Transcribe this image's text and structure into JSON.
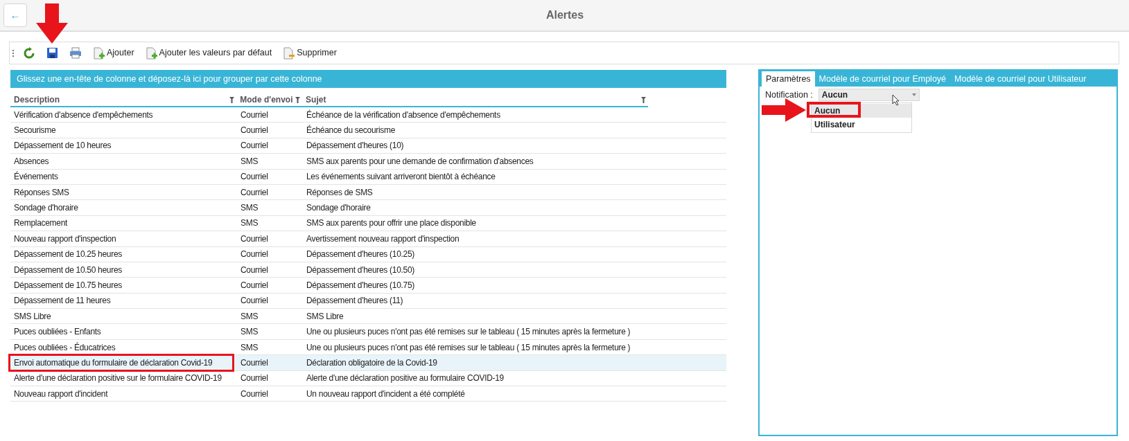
{
  "header": {
    "title": "Alertes",
    "back": "←"
  },
  "toolbar": [
    {
      "kind": "refresh"
    },
    {
      "kind": "save"
    },
    {
      "kind": "print"
    },
    {
      "kind": "add",
      "label": "Ajouter"
    },
    {
      "kind": "add",
      "label": "Ajouter les valeurs par défaut"
    },
    {
      "kind": "delete",
      "label": "Supprimer"
    }
  ],
  "group_panel": "Glissez une en-tête de colonne et déposez-là ici pour grouper par cette colonne",
  "table": {
    "columns": [
      "Description",
      "Mode d'envoi",
      "Sujet"
    ],
    "rows": [
      {
        "description": "Vérification d'absence d'empêchements",
        "mode": "Courriel",
        "subject": "Échéance de la vérification d'absence d'empêchements",
        "selected": false
      },
      {
        "description": "Secourisme",
        "mode": "Courriel",
        "subject": "Échéance du secourisme",
        "selected": false
      },
      {
        "description": "Dépassement de 10 heures",
        "mode": "Courriel",
        "subject": "Dépassement d'heures (10)",
        "selected": false
      },
      {
        "description": "Absences",
        "mode": "SMS",
        "subject": "SMS aux parents pour une demande de confirmation d'absences",
        "selected": false
      },
      {
        "description": "Événements",
        "mode": "Courriel",
        "subject": "Les événements suivant arriveront bientôt à échéance",
        "selected": false
      },
      {
        "description": "Réponses SMS",
        "mode": "Courriel",
        "subject": "Réponses de SMS",
        "selected": false
      },
      {
        "description": "Sondage d'horaire",
        "mode": "SMS",
        "subject": "Sondage d'horaire",
        "selected": false
      },
      {
        "description": "Remplacement",
        "mode": "SMS",
        "subject": "SMS aux parents pour offrir une place disponible",
        "selected": false
      },
      {
        "description": "Nouveau rapport d'inspection",
        "mode": "Courriel",
        "subject": "Avertissement nouveau rapport d'inspection",
        "selected": false
      },
      {
        "description": "Dépassement de 10.25 heures",
        "mode": "Courriel",
        "subject": "Dépassement d'heures (10.25)",
        "selected": false
      },
      {
        "description": "Dépassement de 10.50 heures",
        "mode": "Courriel",
        "subject": "Dépassement d'heures (10.50)",
        "selected": false
      },
      {
        "description": "Dépassement de 10.75 heures",
        "mode": "Courriel",
        "subject": "Dépassement d'heures (10.75)",
        "selected": false
      },
      {
        "description": "Dépassement de 11 heures",
        "mode": "Courriel",
        "subject": "Dépassement d'heures (11)",
        "selected": false
      },
      {
        "description": "SMS Libre",
        "mode": "SMS",
        "subject": "SMS Libre",
        "selected": false
      },
      {
        "description": "Puces oubliées - Enfants",
        "mode": "SMS",
        "subject": "Une ou plusieurs puces n'ont pas été remises sur le tableau ( 15 minutes après la fermeture )",
        "selected": false
      },
      {
        "description": "Puces oubliées - Éducatrices",
        "mode": "SMS",
        "subject": "Une ou plusieurs puces n'ont pas été remises sur le tableau ( 15 minutes après la fermeture )",
        "selected": false
      },
      {
        "description": "Envoi automatique du formulaire de déclaration Covid-19",
        "mode": "Courriel",
        "subject": "Déclaration obligatoire de la Covid-19",
        "selected": true
      },
      {
        "description": "Alerte d'une déclaration positive sur le formulaire COVID-19",
        "mode": "Courriel",
        "subject": "Alerte d'une déclaration positive au formulaire COVID-19",
        "selected": false
      },
      {
        "description": "Nouveau rapport d'incident",
        "mode": "Courriel",
        "subject": "Un nouveau rapport d'incident a été complété",
        "selected": false
      }
    ]
  },
  "detail": {
    "tabs": [
      {
        "label": "Paramètres",
        "selected": true
      },
      {
        "label": "Modèle de courriel pour Employé",
        "selected": false
      },
      {
        "label": "Modèle de courriel pour Utilisateur",
        "selected": false
      }
    ],
    "notification": {
      "label": "Notification :",
      "value": "Aucun",
      "expanded": true,
      "options": [
        {
          "label": "Aucun",
          "selected": true
        },
        {
          "label": "Utilisateur",
          "selected": false
        }
      ]
    }
  }
}
